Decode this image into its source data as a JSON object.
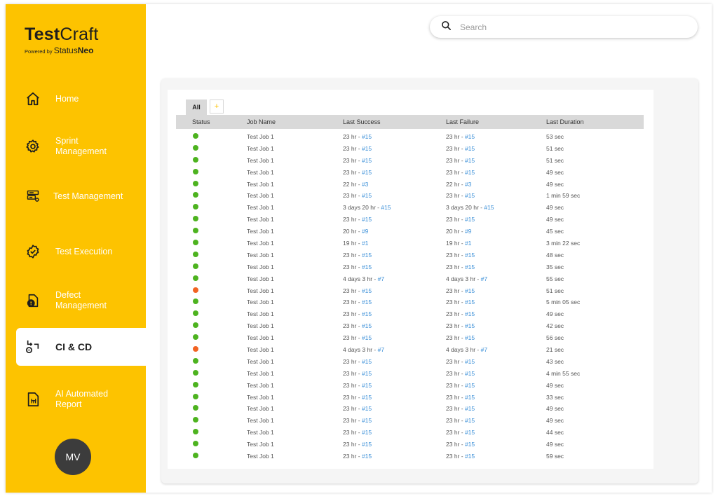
{
  "brand": {
    "title_bold": "Test",
    "title_light": "Craft",
    "powered_by": "Powered by",
    "sub_light": "Status",
    "sub_bold": "Neo"
  },
  "search": {
    "placeholder": "Search",
    "icon": "search-icon"
  },
  "nav": [
    {
      "label": "Home",
      "icon": "home-icon",
      "active": false
    },
    {
      "label": "Sprint Management",
      "icon": "gear-icon",
      "active": false
    },
    {
      "label": "Test Management",
      "icon": "server-icon",
      "active": false
    },
    {
      "label": "Test Execution",
      "icon": "badge-check-icon",
      "active": false
    },
    {
      "label": "Defect Management",
      "icon": "document-alert-icon",
      "active": false
    },
    {
      "label": "CI & CD",
      "icon": "pipeline-icon",
      "active": true
    },
    {
      "label": "AI Automated Report",
      "icon": "report-icon",
      "active": false
    }
  ],
  "avatar": "MV",
  "tabs": {
    "all": "All",
    "add": "+"
  },
  "colors": {
    "sidebar": "#fdc300",
    "success": "#4db31f",
    "failure": "#f26322",
    "link": "#3a8fd8"
  },
  "table": {
    "headers": [
      "Status",
      "Job Name",
      "Last Success",
      "Last Failure",
      "Last Duration"
    ],
    "rows": [
      {
        "status": "success",
        "job": "Test Job 1",
        "succ": "23 hr - ",
        "succ_link": "#15",
        "fail": "23 hr - ",
        "fail_link": "#15",
        "dur": "53 sec"
      },
      {
        "status": "success",
        "job": "Test Job 1",
        "succ": "23 hr - ",
        "succ_link": "#15",
        "fail": "23 hr - ",
        "fail_link": "#15",
        "dur": "51 sec"
      },
      {
        "status": "success",
        "job": "Test Job 1",
        "succ": "23 hr - ",
        "succ_link": "#15",
        "fail": "23 hr - ",
        "fail_link": "#15",
        "dur": "51 sec"
      },
      {
        "status": "success",
        "job": "Test Job 1",
        "succ": "23 hr - ",
        "succ_link": "#15",
        "fail": "23 hr - ",
        "fail_link": "#15",
        "dur": "49 sec"
      },
      {
        "status": "success",
        "job": "Test Job 1",
        "succ": "22 hr - ",
        "succ_link": "#3",
        "fail": "22 hr - ",
        "fail_link": "#3",
        "dur": "49 sec"
      },
      {
        "status": "success",
        "job": "Test Job 1",
        "succ": "23 hr - ",
        "succ_link": "#15",
        "fail": "23 hr - ",
        "fail_link": "#15",
        "dur": "1 min 59 sec"
      },
      {
        "status": "success",
        "job": "Test Job 1",
        "succ": "3 days 20 hr - ",
        "succ_link": "#15",
        "fail": "3 days 20 hr - ",
        "fail_link": "#15",
        "dur": "49 sec"
      },
      {
        "status": "success",
        "job": "Test Job 1",
        "succ": "23 hr - ",
        "succ_link": "#15",
        "fail": "23 hr - ",
        "fail_link": "#15",
        "dur": "49 sec"
      },
      {
        "status": "success",
        "job": "Test Job 1",
        "succ": "20 hr - ",
        "succ_link": "#9",
        "fail": "20 hr - ",
        "fail_link": "#9",
        "dur": "45 sec"
      },
      {
        "status": "success",
        "job": "Test Job 1",
        "succ": "19 hr - ",
        "succ_link": "#1",
        "fail": "19 hr - ",
        "fail_link": "#1",
        "dur": "3 min 22 sec"
      },
      {
        "status": "success",
        "job": "Test Job 1",
        "succ": "23 hr - ",
        "succ_link": "#15",
        "fail": "23 hr - ",
        "fail_link": "#15",
        "dur": "48 sec"
      },
      {
        "status": "success",
        "job": "Test Job 1",
        "succ": "23 hr - ",
        "succ_link": "#15",
        "fail": "23 hr - ",
        "fail_link": "#15",
        "dur": "35 sec"
      },
      {
        "status": "success",
        "job": "Test Job 1",
        "succ": "4 days 3 hr - ",
        "succ_link": "#7",
        "fail": "4 days 3 hr - ",
        "fail_link": "#7",
        "dur": "55 sec"
      },
      {
        "status": "failure",
        "job": "Test Job 1",
        "succ": "23 hr - ",
        "succ_link": "#15",
        "fail": "23 hr - ",
        "fail_link": "#15",
        "dur": "51 sec"
      },
      {
        "status": "success",
        "job": "Test Job 1",
        "succ": "23 hr - ",
        "succ_link": "#15",
        "fail": "23 hr - ",
        "fail_link": "#15",
        "dur": "5 min 05 sec"
      },
      {
        "status": "success",
        "job": "Test Job 1",
        "succ": "23 hr - ",
        "succ_link": "#15",
        "fail": "23 hr - ",
        "fail_link": "#15",
        "dur": "49 sec"
      },
      {
        "status": "success",
        "job": "Test Job 1",
        "succ": "23 hr - ",
        "succ_link": "#15",
        "fail": "23 hr - ",
        "fail_link": "#15",
        "dur": "42 sec"
      },
      {
        "status": "success",
        "job": "Test Job 1",
        "succ": "23 hr - ",
        "succ_link": "#15",
        "fail": "23 hr - ",
        "fail_link": "#15",
        "dur": "56 sec"
      },
      {
        "status": "failure",
        "job": "Test Job 1",
        "succ": "4 days 3 hr - ",
        "succ_link": "#7",
        "fail": "4 days 3 hr - ",
        "fail_link": "#7",
        "dur": "21 sec"
      },
      {
        "status": "success",
        "job": "Test Job 1",
        "succ": "23 hr - ",
        "succ_link": "#15",
        "fail": "23 hr - ",
        "fail_link": "#15",
        "dur": "43 sec"
      },
      {
        "status": "success",
        "job": "Test Job 1",
        "succ": "23 hr - ",
        "succ_link": "#15",
        "fail": "23 hr - ",
        "fail_link": "#15",
        "dur": "4 min 55 sec"
      },
      {
        "status": "success",
        "job": "Test Job 1",
        "succ": "23 hr - ",
        "succ_link": "#15",
        "fail": "23 hr - ",
        "fail_link": "#15",
        "dur": "49 sec"
      },
      {
        "status": "success",
        "job": "Test Job 1",
        "succ": "23 hr - ",
        "succ_link": "#15",
        "fail": "23 hr - ",
        "fail_link": "#15",
        "dur": "33 sec"
      },
      {
        "status": "success",
        "job": "Test Job 1",
        "succ": "23 hr - ",
        "succ_link": "#15",
        "fail": "23 hr - ",
        "fail_link": "#15",
        "dur": "49 sec"
      },
      {
        "status": "success",
        "job": "Test Job 1",
        "succ": "23 hr - ",
        "succ_link": "#15",
        "fail": "23 hr - ",
        "fail_link": "#15",
        "dur": "49 sec"
      },
      {
        "status": "success",
        "job": "Test Job 1",
        "succ": "23 hr - ",
        "succ_link": "#15",
        "fail": "23 hr - ",
        "fail_link": "#15",
        "dur": "44 sec"
      },
      {
        "status": "success",
        "job": "Test Job 1",
        "succ": "23 hr - ",
        "succ_link": "#15",
        "fail": "23 hr - ",
        "fail_link": "#15",
        "dur": "49 sec"
      },
      {
        "status": "success",
        "job": "Test Job 1",
        "succ": "23 hr - ",
        "succ_link": "#15",
        "fail": "23 hr - ",
        "fail_link": "#15",
        "dur": "59 sec"
      }
    ]
  }
}
